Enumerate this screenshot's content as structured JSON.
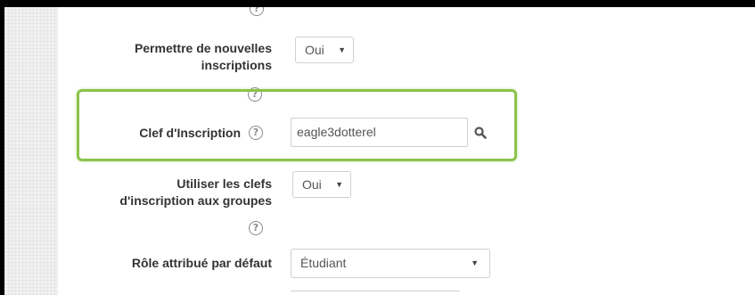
{
  "form": {
    "fields": [
      {
        "label_line1": "Permettre de nouvelles",
        "label_line2": "inscriptions",
        "control": "select",
        "value": "Oui"
      },
      {
        "label": "Clef d'Inscription",
        "control": "text",
        "value": "eagle3dotterel",
        "icon": "search-icon"
      },
      {
        "label_line1": "Utiliser les clefs",
        "label_line2": "d'inscription aux groupes",
        "control": "select",
        "value": "Oui"
      },
      {
        "label": "Rôle attribué par défaut",
        "control": "select",
        "value": "Étudiant"
      }
    ],
    "help_glyph": "?",
    "caret_glyph": "▼"
  },
  "colors": {
    "highlight": "#8bc34a",
    "label_text": "#333333",
    "help_icon": "#8a8a8a"
  }
}
